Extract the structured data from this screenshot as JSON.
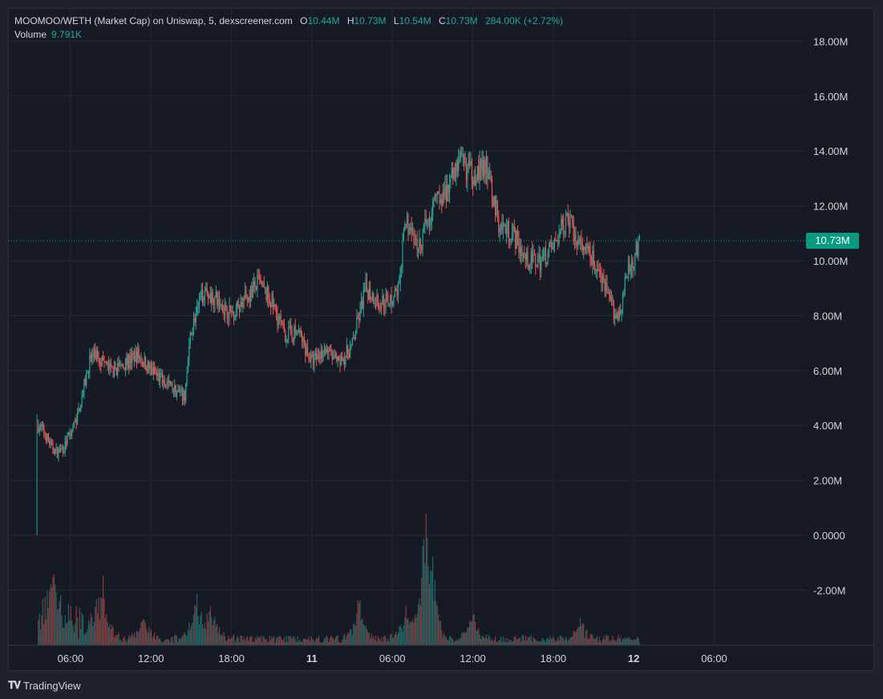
{
  "legend": {
    "title": "MOOMOO/WETH (Market Cap) on Uniswap, 5, dexscreener.com",
    "o_label": "O",
    "o_value": "10.44M",
    "h_label": "H",
    "h_value": "10.73M",
    "l_label": "L",
    "l_value": "10.54M",
    "c_label": "C",
    "c_value": "10.73M",
    "change": "284.00K (+2.72%)",
    "volume_label": "Volume",
    "volume_value": "9.791K"
  },
  "last_price_label": "10.73M",
  "footer": {
    "logo_icon": "tradingview-logo-icon",
    "brand": "TradingView"
  },
  "colors": {
    "up": "#26a69a",
    "down": "#ef5350",
    "background": "#161a25",
    "grid": "#242833",
    "text": "#d1d4dc",
    "last_price": "#089981"
  },
  "chart_data": {
    "type": "candlestick",
    "symbol": "MOOMOO/WETH (Market Cap)",
    "interval_minutes": 5,
    "y_unit": "M",
    "ylim": [
      -4,
      19
    ],
    "y_ticks": [
      18,
      16,
      14,
      12,
      10,
      8,
      6,
      4,
      2,
      0,
      -2
    ],
    "y_tick_labels": [
      "18.00M",
      "16.00M",
      "14.00M",
      "12.00M",
      "10.00M",
      "8.00M",
      "6.00M",
      "4.00M",
      "2.00M",
      "0.0000",
      "-2.00M"
    ],
    "x_ticks": [
      6,
      12,
      18,
      24,
      30,
      36,
      42,
      48,
      54
    ],
    "x_tick_labels": [
      "06:00",
      "12:00",
      "18:00",
      "11",
      "06:00",
      "12:00",
      "18:00",
      "12",
      "06:00"
    ],
    "xlim_hours": [
      1.4,
      58.5
    ],
    "last_close": 10.73,
    "price_path_hours": [
      3.5,
      3.6,
      4.0,
      4.5,
      5.0,
      5.5,
      6.5,
      7.5,
      8.0,
      9.0,
      10.0,
      11.0,
      12.0,
      13.0,
      14.5,
      15.0,
      16.0,
      17.0,
      18.0,
      19.0,
      20.0,
      21.0,
      22.0,
      23.0,
      24.0,
      25.0,
      26.0,
      27.0,
      28.0,
      29.0,
      30.0,
      30.5,
      31.0,
      32.0,
      33.0,
      34.0,
      35.0,
      36.0,
      37.0,
      38.0,
      39.0,
      40.0,
      41.0,
      42.0,
      43.0,
      44.0,
      45.0,
      46.0,
      46.7,
      47.0,
      47.5,
      48.0,
      48.5
    ],
    "price_path_values": [
      0.0,
      4.0,
      3.8,
      3.3,
      3.0,
      3.2,
      4.3,
      6.5,
      6.6,
      6.0,
      6.2,
      6.6,
      6.0,
      5.6,
      5.0,
      7.5,
      9.0,
      8.5,
      8.1,
      8.6,
      9.2,
      8.5,
      7.3,
      7.4,
      6.3,
      6.8,
      6.2,
      6.9,
      9.0,
      8.5,
      8.6,
      9.0,
      11.5,
      10.5,
      12.0,
      12.5,
      13.6,
      13.2,
      13.4,
      11.3,
      11.0,
      10.0,
      10.0,
      10.5,
      11.6,
      10.5,
      10.0,
      8.8,
      8.0,
      8.2,
      9.5,
      10.1,
      10.73
    ],
    "volume_spikes_hours": [
      4.7,
      8.5,
      11.5,
      15.3,
      16.5,
      27.5,
      31.0,
      32.5,
      33.0,
      36.0,
      44.0
    ],
    "volume_spikes_size": [
      0.45,
      0.3,
      0.2,
      0.35,
      0.3,
      0.3,
      0.22,
      1.0,
      0.28,
      0.2,
      0.14
    ]
  }
}
